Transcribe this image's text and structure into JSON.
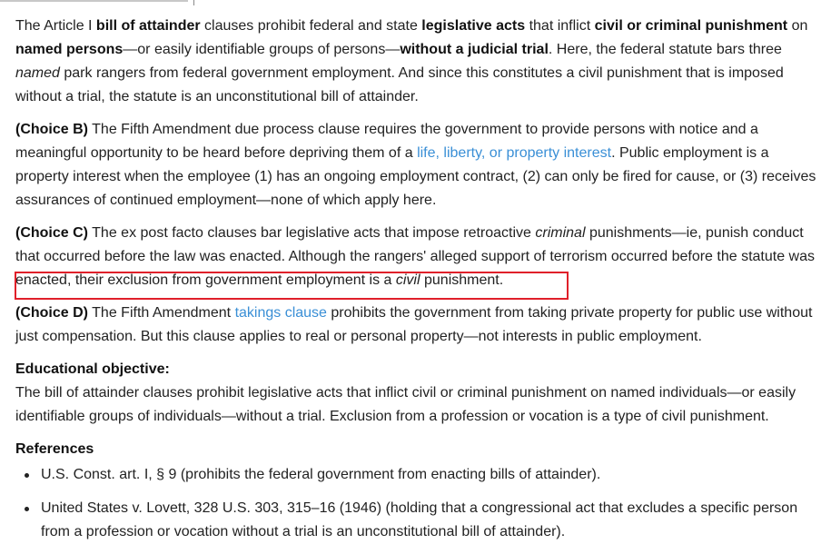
{
  "p1": {
    "t1": "The Article I ",
    "b1": "bill of attainder",
    "t2": " clauses prohibit federal and state ",
    "b2": "legislative acts",
    "t3": " that inflict ",
    "b3": "civil or criminal punishment",
    "t4": " on ",
    "b4": "named persons",
    "t5": "—or easily identifiable groups of persons—",
    "b5": "without a judicial trial",
    "t6": ".  Here, the federal statute bars three ",
    "i1": "named",
    "t7": " park rangers from federal government employment.  And since this constitutes a civil punishment that is imposed without a trial, the statute is an unconstitutional bill of attainder."
  },
  "p2": {
    "choice": "(Choice B)",
    "t1": "  The Fifth Amendment due process clause requires the government to provide persons with notice and a meaningful opportunity to be heard before depriving them of a ",
    "link": "life, liberty, or property interest",
    "t2": ".  Public employment is a property interest when the employee (1) has an ongoing employment contract, (2) can only be fired for cause, or (3) receives assurances of continued employment—none of which apply here."
  },
  "p3": {
    "choice": "(Choice C)",
    "t1": "  The ex post facto clauses bar legislative acts that impose retroactive ",
    "i1": "criminal",
    "t2": " punishments—ie, punish conduct that occurred before the law was enacted.  Although the rangers' alleged support of terrorism occurred before the statute was enacted, their exclusion from government employment is a ",
    "i2": "civil",
    "t3": " punishment."
  },
  "p4": {
    "choice": "(Choice D)",
    "t1": "  The Fifth Amendment ",
    "link": "takings clause",
    "t2": " prohibits the government from taking private property for public use without just compensation.  But this clause applies to real or personal property—not interests in public employment."
  },
  "edu": {
    "heading": "Educational objective:",
    "text": "The bill of attainder clauses prohibit legislative acts that inflict civil or criminal punishment on named individuals—or easily identifiable groups of individuals—without a trial.  Exclusion from a profession or vocation is a type of civil punishment."
  },
  "refs": {
    "heading": "References",
    "items": [
      "U.S. Const. art. I, § 9 (prohibits the federal government from enacting bills of attainder).",
      "United States v. Lovett, 328 U.S. 303, 315–16 (1946) (holding that a congressional act that excludes a specific person from a profession or vocation without a trial is an unconstitutional bill of attainder)."
    ]
  },
  "colors": {
    "link": "#3a8fd6",
    "highlight": "#e0202a"
  }
}
